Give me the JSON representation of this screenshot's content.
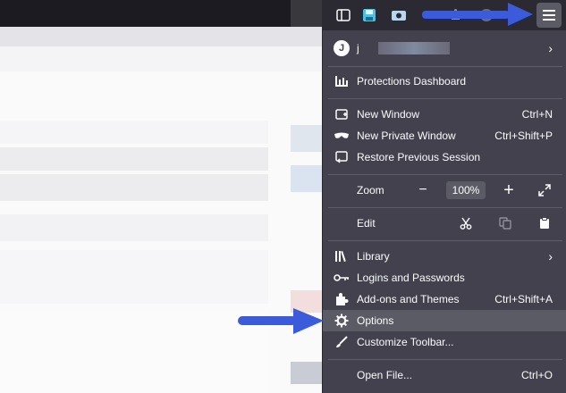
{
  "account": {
    "avatar_initial": "J",
    "name": "j"
  },
  "menu": {
    "protections": "Protections Dashboard",
    "new_window": {
      "label": "New Window",
      "shortcut": "Ctrl+N"
    },
    "new_private": {
      "label": "New Private Window",
      "shortcut": "Ctrl+Shift+P"
    },
    "restore": {
      "label": "Restore Previous Session"
    },
    "zoom": {
      "label": "Zoom",
      "value": "100%"
    },
    "edit": {
      "label": "Edit"
    },
    "library": {
      "label": "Library"
    },
    "logins": {
      "label": "Logins and Passwords"
    },
    "addons": {
      "label": "Add-ons and Themes",
      "shortcut": "Ctrl+Shift+A"
    },
    "options": {
      "label": "Options"
    },
    "customize": {
      "label": "Customize Toolbar..."
    },
    "open_file": {
      "label": "Open File...",
      "shortcut": "Ctrl+O"
    }
  },
  "colors": {
    "panel_bg": "#42414d",
    "highlight": "#5b5b66",
    "arrow": "#3b5bdb",
    "toolbar": "#2b2a33"
  },
  "icons": [
    "sidebar-icon",
    "save-icon",
    "screenshot-icon",
    "extension-icon",
    "hamburger-menu-icon"
  ]
}
